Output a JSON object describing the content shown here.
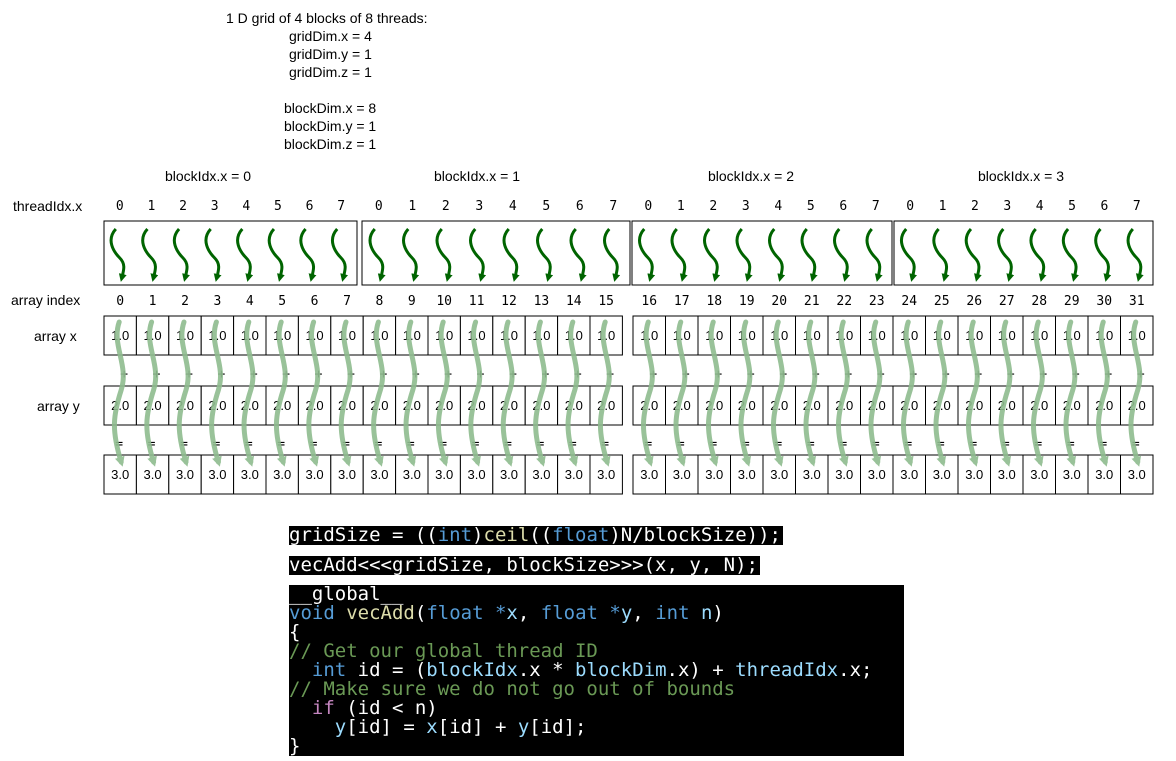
{
  "header": {
    "lines": [
      "1 D grid of 4 blocks of 8 threads:",
      "gridDim.x = 4",
      "gridDim.y = 1",
      "gridDim.z = 1",
      "blockDim.x = 8",
      "blockDim.y = 1",
      "blockDim.z = 1"
    ]
  },
  "blocks": [
    {
      "label": "blockIdx.x = 0",
      "threads": [
        "0",
        "1",
        "2",
        "3",
        "4",
        "5",
        "6",
        "7"
      ]
    },
    {
      "label": "blockIdx.x = 1",
      "threads": [
        "0",
        "1",
        "2",
        "3",
        "4",
        "5",
        "6",
        "7"
      ]
    },
    {
      "label": "blockIdx.x = 2",
      "threads": [
        "0",
        "1",
        "2",
        "3",
        "4",
        "5",
        "6",
        "7"
      ]
    },
    {
      "label": "blockIdx.x = 3",
      "threads": [
        "0",
        "1",
        "2",
        "3",
        "4",
        "5",
        "6",
        "7"
      ]
    }
  ],
  "row_labels": {
    "thread_idx": "threadIdx.x",
    "array_index": "array index",
    "array_x": "array x",
    "array_y": "array y"
  },
  "array_index": [
    "0",
    "1",
    "2",
    "3",
    "4",
    "5",
    "6",
    "7",
    "8",
    "9",
    "10",
    "11",
    "12",
    "13",
    "14",
    "15",
    "16",
    "17",
    "18",
    "19",
    "20",
    "21",
    "22",
    "23",
    "24",
    "25",
    "26",
    "27",
    "28",
    "29",
    "30",
    "31"
  ],
  "array_x_value": "1.0",
  "array_y_value": "2.0",
  "result_value": "3.0",
  "plus_symbol": "+",
  "equals_symbol": "=",
  "code": {
    "line1": [
      {
        "t": "gridSize = ((",
        "c": ""
      },
      {
        "t": "int",
        "c": "kw"
      },
      {
        "t": ")",
        "c": ""
      },
      {
        "t": "ceil",
        "c": "fn"
      },
      {
        "t": "((",
        "c": ""
      },
      {
        "t": "float",
        "c": "kw"
      },
      {
        "t": ")N/blockSize));",
        "c": ""
      }
    ],
    "line2": [
      {
        "t": "vecAdd<<<gridSize, blockSize>>>(x, y, N);",
        "c": ""
      }
    ],
    "kernel": [
      [
        {
          "t": "__global__",
          "c": ""
        }
      ],
      [
        {
          "t": "void",
          "c": "kw"
        },
        {
          "t": " ",
          "c": ""
        },
        {
          "t": "vecAdd",
          "c": "fn"
        },
        {
          "t": "(",
          "c": ""
        },
        {
          "t": "float",
          "c": "kw"
        },
        {
          "t": " *",
          "c": "kw"
        },
        {
          "t": "x",
          "c": "vr"
        },
        {
          "t": ", ",
          "c": ""
        },
        {
          "t": "float",
          "c": "kw"
        },
        {
          "t": " *",
          "c": "kw"
        },
        {
          "t": "y",
          "c": "vr"
        },
        {
          "t": ", ",
          "c": ""
        },
        {
          "t": "int",
          "c": "kw"
        },
        {
          "t": " ",
          "c": ""
        },
        {
          "t": "n",
          "c": "vr"
        },
        {
          "t": ")",
          "c": ""
        }
      ],
      [
        {
          "t": "{",
          "c": ""
        }
      ],
      [
        {
          "t": "// Get our global thread ID",
          "c": "cm"
        }
      ],
      [
        {
          "t": "  ",
          "c": ""
        },
        {
          "t": "int",
          "c": "kw"
        },
        {
          "t": " id = (",
          "c": ""
        },
        {
          "t": "blockIdx",
          "c": "id"
        },
        {
          "t": ".x * ",
          "c": ""
        },
        {
          "t": "blockDim",
          "c": "id"
        },
        {
          "t": ".x) + ",
          "c": ""
        },
        {
          "t": "threadIdx",
          "c": "id"
        },
        {
          "t": ".x;",
          "c": ""
        }
      ],
      [
        {
          "t": "// Make sure we do not go out of bounds",
          "c": "cm"
        }
      ],
      [
        {
          "t": "  ",
          "c": ""
        },
        {
          "t": "if",
          "c": "ctl"
        },
        {
          "t": " (id < n)",
          "c": ""
        }
      ],
      [
        {
          "t": "    ",
          "c": ""
        },
        {
          "t": "y",
          "c": "vr"
        },
        {
          "t": "[id] = ",
          "c": ""
        },
        {
          "t": "x",
          "c": "vr"
        },
        {
          "t": "[id] + ",
          "c": ""
        },
        {
          "t": "y",
          "c": "vr"
        },
        {
          "t": "[id];",
          "c": ""
        }
      ],
      [
        {
          "t": "}",
          "c": ""
        }
      ]
    ]
  },
  "colors": {
    "thread_arrow": "#006400",
    "flow_arrow": "#8fbc8f",
    "code_bg": "#000000",
    "code_text": "#ffffff",
    "keyword": "#569cd6",
    "function": "#dcdcaa",
    "comment": "#6a9955"
  }
}
